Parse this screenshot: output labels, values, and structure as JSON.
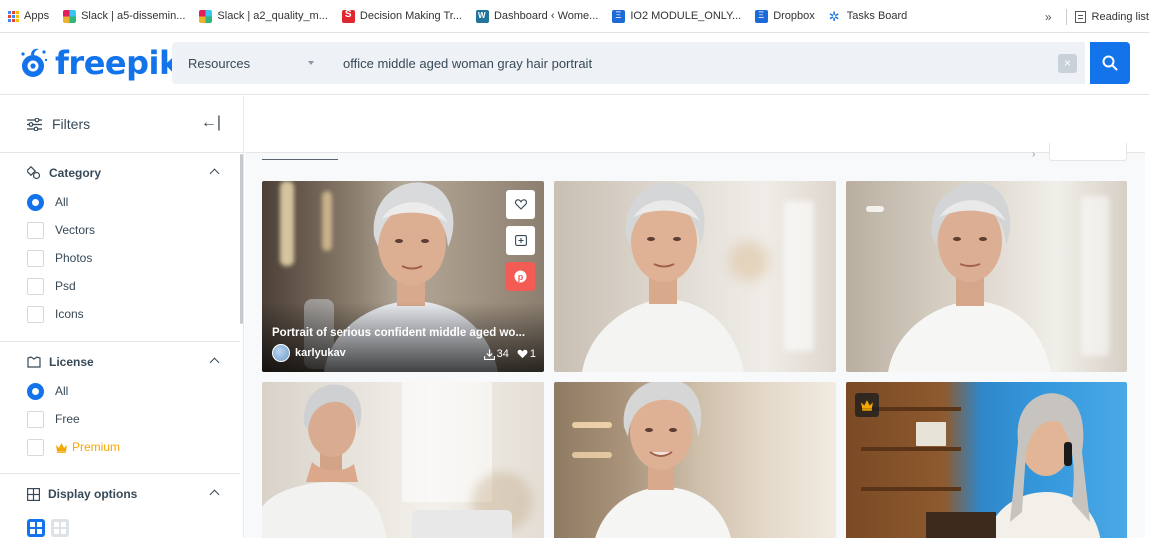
{
  "bookmarks": {
    "items": [
      {
        "label": "Apps",
        "icon": "apps-grid-icon"
      },
      {
        "label": "Slack | a5-dissemin...",
        "icon": "slack-icon"
      },
      {
        "label": "Slack | a2_quality_m...",
        "icon": "slack-icon"
      },
      {
        "label": "Decision Making Tr...",
        "icon": "decision-making-icon"
      },
      {
        "label": "Dashboard ‹ Wome...",
        "icon": "wordpress-icon"
      },
      {
        "label": "IO2 MODULE_ONLY...",
        "icon": "io2-icon"
      },
      {
        "label": "Dropbox",
        "icon": "dropbox-icon"
      },
      {
        "label": "Tasks Board",
        "icon": "tasks-board-icon"
      }
    ],
    "more": "»",
    "reading_list": "Reading list"
  },
  "header": {
    "logo_text": "freepik",
    "resource_type": "Resources",
    "search_query": "office middle aged woman gray hair portrait",
    "brand_color": "#1273eb"
  },
  "sidebar": {
    "title": "Filters",
    "category": {
      "label": "Category",
      "options": [
        {
          "label": "All",
          "selected": true
        },
        {
          "label": "Vectors",
          "selected": false
        },
        {
          "label": "Photos",
          "selected": false
        },
        {
          "label": "Psd",
          "selected": false
        },
        {
          "label": "Icons",
          "selected": false
        }
      ]
    },
    "license": {
      "label": "License",
      "options": [
        {
          "label": "All",
          "selected": true
        },
        {
          "label": "Free",
          "selected": false
        },
        {
          "label": "Premium",
          "selected": false
        }
      ]
    },
    "display": {
      "label": "Display options"
    }
  },
  "results": {
    "cards": [
      {
        "title": "Portrait of serious confident middle aged wo...",
        "author": "karlyukav",
        "downloads": "34",
        "likes": "1",
        "hovered": true,
        "premium": false
      },
      {
        "hovered": false,
        "premium": false
      },
      {
        "hovered": false,
        "premium": false
      },
      {
        "hovered": false,
        "premium": false
      },
      {
        "hovered": false,
        "premium": false
      },
      {
        "hovered": false,
        "premium": true
      }
    ]
  }
}
